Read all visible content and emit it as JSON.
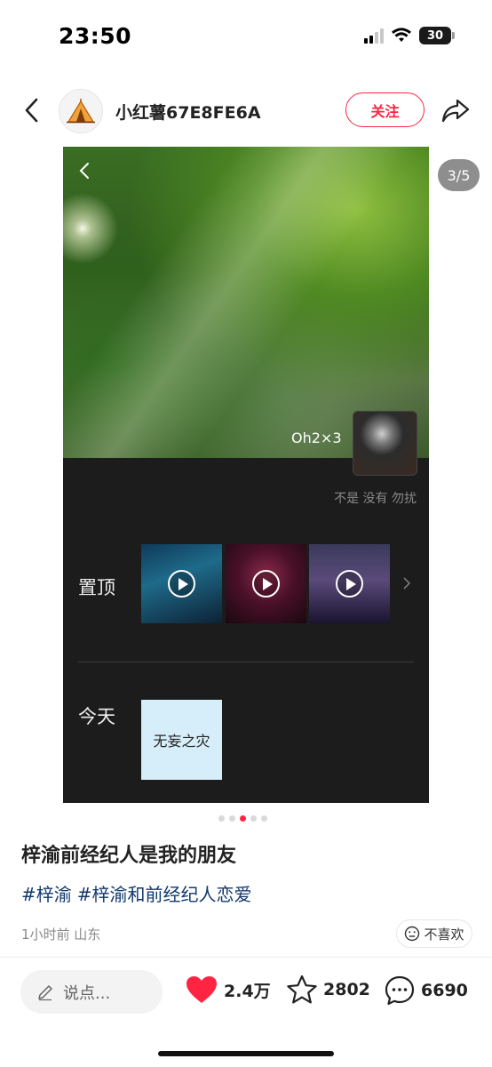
{
  "status_bar": {
    "time": "23:50",
    "battery": "30"
  },
  "header": {
    "username": "小红薯67E8FE6A",
    "follow_label": "关注"
  },
  "media": {
    "counter": "3/5",
    "tag_text": "Oh2×3",
    "hint": "不是 没有 勿扰",
    "pinned_label": "置顶",
    "today_label": "今天",
    "today_card_text": "无妄之灾"
  },
  "pagination": {
    "total": 5,
    "active_index": 2
  },
  "post": {
    "title": "梓渝前经纪人是我的朋友",
    "tags": [
      "#梓渝",
      "#梓渝和前经纪人恋爱"
    ],
    "meta": "1小时前 山东",
    "dislike_label": "不喜欢"
  },
  "bottom_bar": {
    "comment_placeholder": "说点...",
    "likes": "2.4万",
    "collects": "2802",
    "comments": "6690"
  },
  "colors": {
    "accent": "#ff2442",
    "tag": "#13386c"
  }
}
